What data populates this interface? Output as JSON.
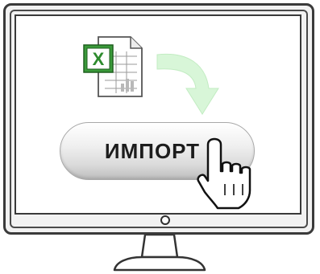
{
  "import_button": {
    "label": "ИМПОРТ"
  },
  "icons": {
    "spreadsheet": "excel-file-icon",
    "arrow": "curved-arrow-icon",
    "cursor": "hand-pointer-icon",
    "power": "power-indicator"
  },
  "colors": {
    "excel_green": "#2e8b2e",
    "arrow_green": "#d4f4d4",
    "frame": "#3a3a3a",
    "screen": "#ffffff"
  }
}
